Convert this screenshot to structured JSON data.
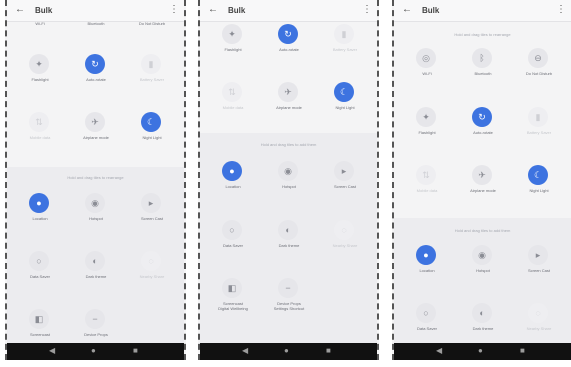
{
  "phones": [
    {
      "app_title": "Bulk",
      "back_icon": "arrow-left-icon",
      "menu_icon": "more-vert-icon",
      "section_caption": "Hold and drag tiles to rearrange",
      "top_labels": [
        "Wi-Fi",
        "Bluetooth",
        "Do Not Disturb"
      ],
      "tiles_top": [
        {
          "label": "Flashlight",
          "icon": "flashlight-icon",
          "state": "off"
        },
        {
          "label": "Auto-rotate",
          "icon": "rotate-icon",
          "state": "on"
        },
        {
          "label": "Battery Saver",
          "icon": "battery-icon",
          "state": "dim"
        },
        {
          "label": "Mobile data",
          "icon": "mobile-data-icon",
          "state": "dim"
        },
        {
          "label": "Airplane mode",
          "icon": "airplane-icon",
          "state": "off"
        },
        {
          "label": "Night Light",
          "icon": "moon-icon",
          "state": "on"
        }
      ],
      "tiles_bottom": [
        {
          "label": "Location",
          "icon": "location-icon",
          "state": "on"
        },
        {
          "label": "Hotspot",
          "icon": "hotspot-icon",
          "state": "off"
        },
        {
          "label": "Screen Cast",
          "icon": "cast-icon",
          "state": "off"
        },
        {
          "label": "Data Saver",
          "icon": "data-saver-icon",
          "state": "off"
        },
        {
          "label": "Dark theme",
          "icon": "dark-theme-icon",
          "state": "off"
        },
        {
          "label": "Nearby Share",
          "icon": "nearby-icon",
          "state": "dim"
        },
        {
          "label": "Screencast",
          "icon": "screencast-icon",
          "state": "off"
        },
        {
          "label": "Device Props",
          "icon": "device-icon",
          "state": "off"
        }
      ]
    },
    {
      "app_title": "Bulk",
      "back_icon": "arrow-left-icon",
      "menu_icon": "more-vert-icon",
      "section_caption": "Hold and drag tiles to add them",
      "tiles_top": [
        {
          "label": "Flashlight",
          "icon": "flashlight-icon",
          "state": "off"
        },
        {
          "label": "Auto-rotate",
          "icon": "rotate-icon",
          "state": "on"
        },
        {
          "label": "Battery Saver",
          "icon": "battery-icon",
          "state": "dim"
        },
        {
          "label": "Mobile data",
          "icon": "mobile-data-icon",
          "state": "dim"
        },
        {
          "label": "Airplane mode",
          "icon": "airplane-icon",
          "state": "off"
        },
        {
          "label": "Night Light",
          "icon": "moon-icon",
          "state": "on"
        }
      ],
      "tiles_bottom": [
        {
          "label": "Location",
          "icon": "location-icon",
          "state": "on"
        },
        {
          "label": "Hotspot",
          "icon": "hotspot-icon",
          "state": "off"
        },
        {
          "label": "Screen Cast",
          "icon": "cast-icon",
          "state": "off"
        },
        {
          "label": "Data Saver",
          "icon": "data-saver-icon",
          "state": "off"
        },
        {
          "label": "Dark theme",
          "icon": "dark-theme-icon",
          "state": "off"
        },
        {
          "label": "Nearby Share",
          "icon": "nearby-icon",
          "state": "dim"
        },
        {
          "label": "Screencast\nDigital Wellbeing",
          "icon": "screencast-icon",
          "state": "off"
        },
        {
          "label": "Device Props\nSettings Shortcut",
          "icon": "device-icon",
          "state": "off"
        }
      ]
    },
    {
      "app_title": "Bulk",
      "back_icon": "arrow-left-icon",
      "menu_icon": "more-vert-icon",
      "top_caption": "Hold and drag tiles to rearrange",
      "section_caption": "Hold and drag tiles to add them",
      "tiles_top": [
        {
          "label": "Wi-Fi",
          "icon": "wifi-icon",
          "state": "off"
        },
        {
          "label": "Bluetooth",
          "icon": "bluetooth-icon",
          "state": "off"
        },
        {
          "label": "Do Not Disturb",
          "icon": "dnd-icon",
          "state": "off"
        },
        {
          "label": "Flashlight",
          "icon": "flashlight-icon",
          "state": "off"
        },
        {
          "label": "Auto-rotate",
          "icon": "rotate-icon",
          "state": "on"
        },
        {
          "label": "Battery Saver",
          "icon": "battery-icon",
          "state": "dim"
        },
        {
          "label": "Mobile data",
          "icon": "mobile-data-icon",
          "state": "dim"
        },
        {
          "label": "Airplane mode",
          "icon": "airplane-icon",
          "state": "off"
        },
        {
          "label": "Night Light",
          "icon": "moon-icon",
          "state": "on"
        }
      ],
      "tiles_bottom": [
        {
          "label": "Location",
          "icon": "location-icon",
          "state": "on"
        },
        {
          "label": "Hotspot",
          "icon": "hotspot-icon",
          "state": "off"
        },
        {
          "label": "Screen Cast",
          "icon": "cast-icon",
          "state": "off"
        },
        {
          "label": "Data Saver",
          "icon": "data-saver-icon",
          "state": "off"
        },
        {
          "label": "Dark theme",
          "icon": "dark-theme-icon",
          "state": "off"
        },
        {
          "label": "Nearby Share",
          "icon": "nearby-icon",
          "state": "dim"
        }
      ]
    }
  ],
  "navbar": {
    "back_glyph": "◀",
    "home_glyph": "●",
    "recents_glyph": "■"
  },
  "colors": {
    "accent": "#3d73e0",
    "tile_off": "#e6e6ea",
    "section_bg": "#ececef",
    "navbar": "#111111"
  }
}
